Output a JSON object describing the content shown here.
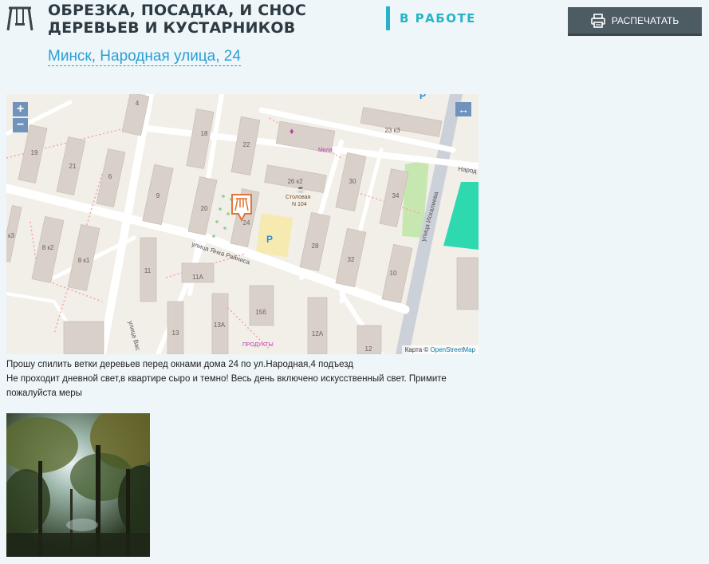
{
  "header": {
    "title_line1": "Обрезка, посадка, и снос",
    "title_line2": "деревьев и кустарников",
    "address": "Минск, Народная улица, 24",
    "status": "В РАБОТЕ",
    "print_label": "РАСПЕЧАТАТЬ"
  },
  "map": {
    "zoom_in": "+",
    "zoom_out": "−",
    "expand": "↔",
    "attribution_prefix": "Карта ©",
    "attribution_link": "OpenStreetMap",
    "street_1": "улица Янка Райниса",
    "street_2": "улица Искалиева",
    "street_3": "улица Вас",
    "street_4": "Народ",
    "poi_canteen": "Столовая",
    "poi_canteen_no": "N 104",
    "poi_mila": "Мила",
    "poi_products": "ПРОДУКТЫ",
    "parking": "P",
    "buildings": {
      "b4": "4",
      "b18": "18",
      "b22": "22",
      "b23": "23 к3",
      "b19": "19",
      "b21": "21",
      "b6": "6",
      "b26": "26 к2",
      "b30": "30",
      "b34": "34",
      "b9": "9",
      "b20": "20",
      "b24": "24",
      "bk3": "к3",
      "b8k2": "8 к2",
      "b8k1": "8 к1",
      "b28": "28",
      "b32": "32",
      "b10": "10",
      "b11": "11",
      "b11a": "11А",
      "b13": "13",
      "b13a": "13А",
      "b15b": "15б",
      "b12a": "12А",
      "b12": "12"
    }
  },
  "description": {
    "line1": "Прошу спилить ветки деревьев перед окнами дома 24 по ул.Народная,4 подъезд",
    "line2": "Не проходит дневной свет,в квартире сыро и темно! Весь день включено искусственный свет. Примите пожалуйста меры"
  },
  "colors": {
    "accent": "#2a9fd6",
    "status": "#27b3c6",
    "button": "#4d5b63"
  }
}
